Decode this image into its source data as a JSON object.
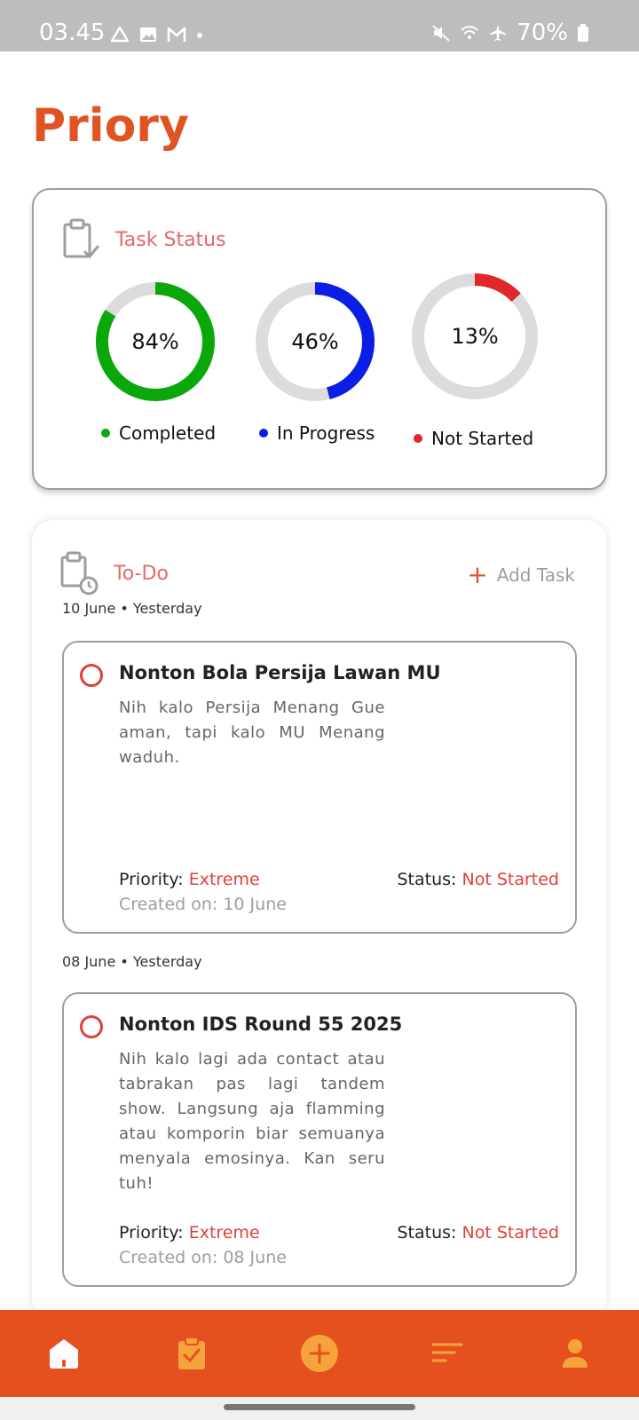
{
  "status_bar": {
    "time": "03.45",
    "battery": "70%",
    "left_icons": [
      "drive-icon",
      "gallery-icon",
      "gmail-icon",
      "dot-icon"
    ],
    "right_icons": [
      "mute-icon",
      "wifi-icon",
      "airplane-icon",
      "battery-icon"
    ]
  },
  "app": {
    "title": "Priory",
    "accent_color": "#e05423"
  },
  "task_status": {
    "heading": "Task Status",
    "items": [
      {
        "label": "Completed",
        "percent": "84%",
        "value": 0.84,
        "color": "#0aa80a"
      },
      {
        "label": "In Progress",
        "percent": "46%",
        "value": 0.46,
        "color": "#0a1ee6"
      },
      {
        "label": "Not Started",
        "percent": "13%",
        "value": 0.13,
        "color": "#e0282a"
      }
    ]
  },
  "todo": {
    "heading": "To-Do",
    "add_label": "Add Task",
    "groups": [
      {
        "date": "10 June • Yesterday",
        "task": {
          "title": "Nonton Bola Persija Lawan MU",
          "description": "Nih kalo Persija Menang Gue aman, tapi kalo MU Menang waduh.",
          "priority_label": "Priority:",
          "priority": "Extreme",
          "status_label": "Status:",
          "status": "Not Started",
          "created": "Created on: 10 June"
        }
      },
      {
        "date": "08 June • Yesterday",
        "task": {
          "title": "Nonton IDS Round 55 2025",
          "description": "Nih kalo lagi ada contact atau tabrakan pas lagi tandem show. Langsung aja flamming atau komporin biar semuanya menyala emosinya. Kan seru tuh!",
          "priority_label": "Priority:",
          "priority": "Extreme",
          "status_label": "Status:",
          "status": "Not Started",
          "created": "Created on: 08 June"
        }
      }
    ]
  },
  "bottom_nav": {
    "items": [
      "home-icon",
      "tasks-icon",
      "add-icon",
      "filter-icon",
      "profile-icon"
    ]
  }
}
